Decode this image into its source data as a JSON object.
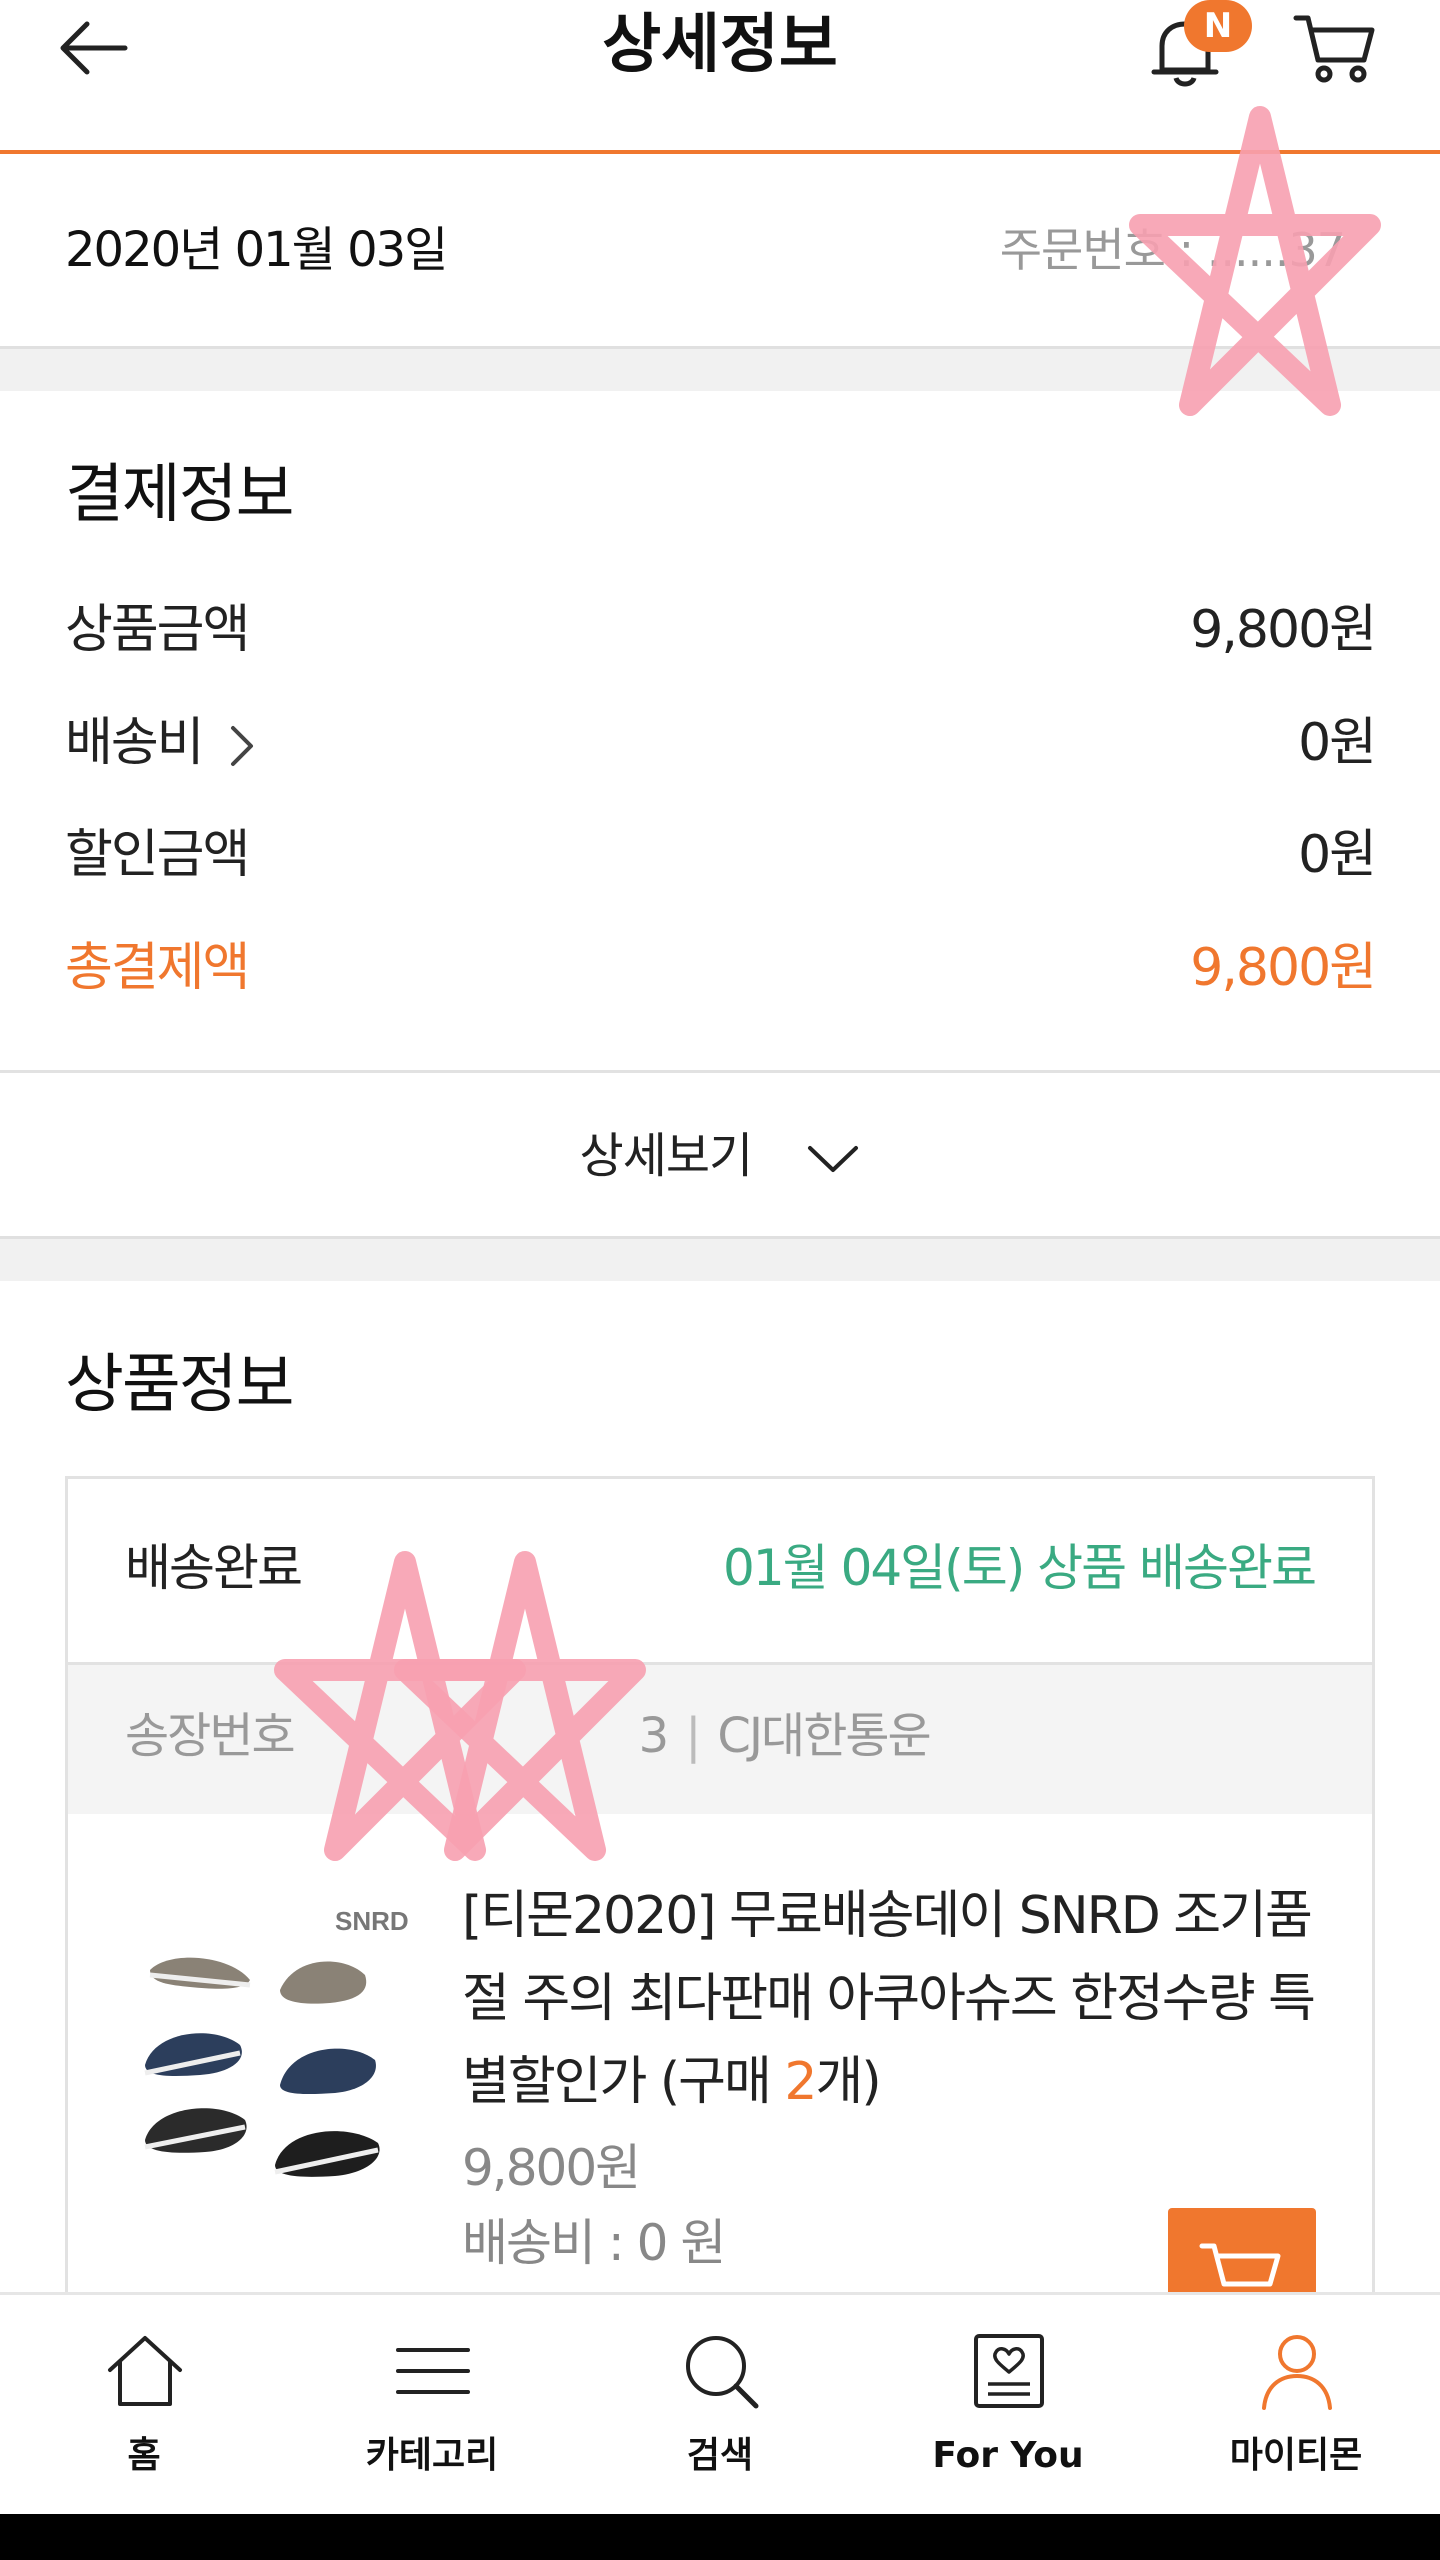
{
  "header": {
    "title": "상세정보",
    "notification_badge": "N",
    "back_icon": "arrow-left-icon",
    "bell_icon": "bell-icon",
    "cart_icon": "cart-icon"
  },
  "order": {
    "date": "2020년 01월 03일",
    "order_number_label": "주문번호 : ......37"
  },
  "payment": {
    "title": "결제정보",
    "rows": [
      {
        "label": "상품금액",
        "value": "9,800원"
      },
      {
        "label": "배송비",
        "value": "0원"
      },
      {
        "label": "할인금액",
        "value": "0원"
      },
      {
        "label": "총결제액",
        "value": "9,800원"
      }
    ],
    "detail_button": "상세보기"
  },
  "product_section": {
    "title": "상품정보",
    "status": "배송완료",
    "delivery_info": "01월 04일(토) 상품 배송완료",
    "tracking_label": "송장번호",
    "tracking_number_tail": "3",
    "carrier": "CJ대한통운",
    "product_name_before": "[티몬2020] 무료배송데이 SNRD 조기품절 주의 최다판매 아쿠아슈즈 한정수량 특별할인가 (구매 ",
    "purchase_count": "2",
    "product_name_after": "개)",
    "brand_on_image": "SNRD",
    "price": "9,800원",
    "shipping_fee": "배송비 : 0 원"
  },
  "tabs": [
    {
      "label": "홈",
      "icon": "home-icon"
    },
    {
      "label": "카테고리",
      "icon": "menu-icon"
    },
    {
      "label": "검색",
      "icon": "search-icon"
    },
    {
      "label": "For You",
      "icon": "heart-frame-icon"
    },
    {
      "label": "마이티몬",
      "icon": "person-icon"
    }
  ],
  "colors": {
    "accent": "#f0772e",
    "delivered": "#3aaa82",
    "muted": "#999999",
    "stamp": "#f7a0b0"
  }
}
